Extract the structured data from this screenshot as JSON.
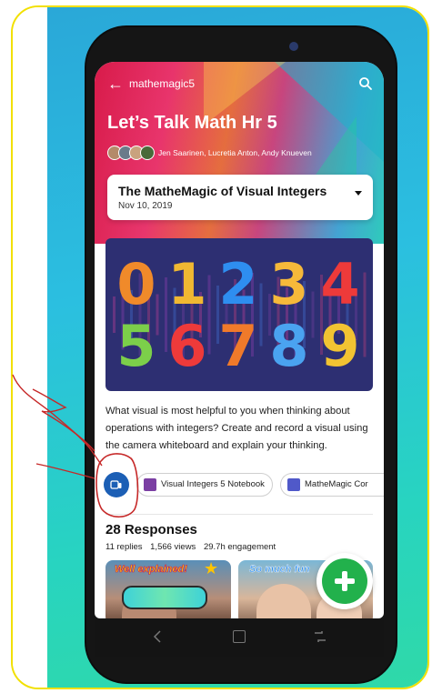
{
  "channel": {
    "name": "mathemagic5"
  },
  "meeting": {
    "title": "Let’s Talk Math Hr 5",
    "members": "Jen Saarinen, Lucretia Anton, Andy Knueven"
  },
  "topic": {
    "title": "The MatheMagic of Visual Integers",
    "date": "Nov 10, 2019"
  },
  "banner": {
    "digits": [
      "0",
      "1",
      "2",
      "3",
      "4",
      "5",
      "6",
      "7",
      "8",
      "9"
    ],
    "digit_colors": [
      "#f08a2a",
      "#f0b832",
      "#2e8ef0",
      "#f6b93a",
      "#ee3a3a",
      "#7ccf4a",
      "#ee3a3a",
      "#f07a2a",
      "#4aa3f0",
      "#f2c332"
    ]
  },
  "prompt": {
    "text": "What visual is most helpful to you when thinking about operations with integers? Create and record a visual using the camera whiteboard and explain your thinking."
  },
  "resources": [
    {
      "label": "Visual Integers 5 Notebook",
      "icon": "onenote-icon",
      "color": "#7b3fa3"
    },
    {
      "label": "MatheMagic Cor",
      "icon": "teams-icon",
      "color": "#5059c9"
    }
  ],
  "responses": {
    "title": "28 Responses",
    "replies": "11 replies",
    "views": "1,566 views",
    "engagement": "29.7h engagement"
  },
  "thumbnails": [
    {
      "label": "Well explained!"
    },
    {
      "label": "So much fun"
    }
  ],
  "colors": {
    "fab": "#22b14c",
    "record_button": "#1c5fb5",
    "annotation": "#c62828",
    "border": "#f2e000"
  }
}
